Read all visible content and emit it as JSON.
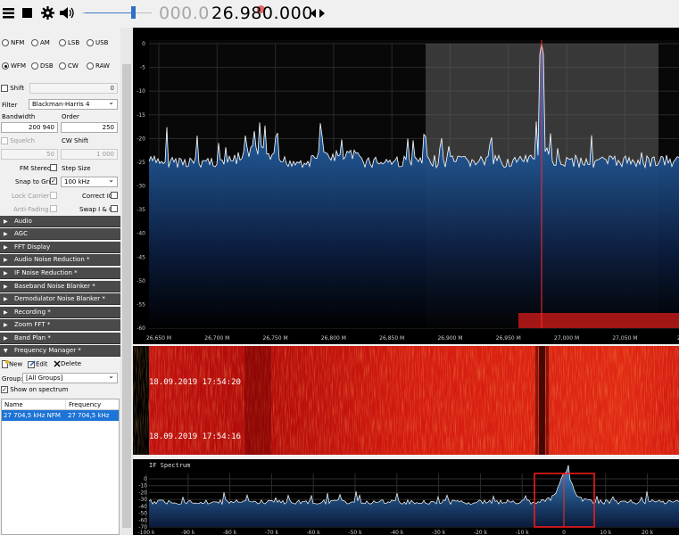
{
  "toolbar": {
    "freq_dim": "000.0",
    "freq_main": "26.980.000",
    "menu_icon": "hamburger-icon",
    "stop_icon": "stop-icon",
    "settings_icon": "gear-icon",
    "volume_icon": "speaker-icon",
    "tune_arrows_icon": "left-right-arrows-icon"
  },
  "radio": {
    "modes_row1": [
      "NFM",
      "AM",
      "LSB",
      "USB"
    ],
    "modes_row2": [
      "WFM",
      "DSB",
      "CW",
      "RAW"
    ],
    "selected": "WFM",
    "shift_label": "Shift",
    "shift_value": "0",
    "filter_label": "Filter",
    "filter_value": "Blackman-Harris 4",
    "bandwidth_label": "Bandwidth",
    "bandwidth_value": "200 940",
    "order_label": "Order",
    "order_value": "250",
    "squelch_label": "Squelch",
    "squelch_value": "50",
    "cw_shift_label": "CW Shift",
    "cw_shift_value": "1 000",
    "fm_stereo_label": "FM Stereo",
    "step_size_label": "Step Size",
    "snap_label": "Snap to Grid",
    "step_value": "100 kHz",
    "lock_carrier_label": "Lock Carrier",
    "correct_iq_label": "Correct IQ",
    "anti_fading_label": "Anti-Fading",
    "swap_iq_label": "Swap I & Q"
  },
  "sections": [
    "Audio",
    "AGC",
    "FFT Display",
    "Audio Noise Reduction *",
    "IF Noise Reduction *",
    "Baseband Noise Blanker *",
    "Demodulator Noise Blanker *",
    "Recording *",
    "Zoom FFT *",
    "Band Plan *",
    "Frequency Manager *"
  ],
  "freq_manager": {
    "new_label": "New",
    "edit_label": "Edit",
    "delete_label": "Delete",
    "group_label": "Group:",
    "group_value": "[All Groups]",
    "show_label": "Show on spectrum",
    "col_name": "Name",
    "col_freq": "Frequency",
    "row_name": "27 704,5 kHz NFM",
    "row_freq": "27 704,5 kHz"
  },
  "spectrum": {
    "y_ticks": [
      "0",
      "-5",
      "-10",
      "-15",
      "-20",
      "-25",
      "-30",
      "-35",
      "-40",
      "-45",
      "-50",
      "-55",
      "-60"
    ],
    "x_ticks": [
      "26,650 M",
      "26,700 M",
      "26,750 M",
      "26,800 M",
      "26,850 M",
      "26,900 M",
      "26,950 M",
      "27,000 M",
      "27,050 M",
      "27,1"
    ]
  },
  "waterfall": {
    "time1": "18.09.2019 17:54:20",
    "time2": "18.09.2019 17:54:16"
  },
  "if_spectrum": {
    "title": "IF Spectrum",
    "y_ticks": [
      "0",
      "-10",
      "-20",
      "-30",
      "-40",
      "-50",
      "-60",
      "-70"
    ],
    "x_ticks": [
      "-100 k",
      "-90 k",
      "-80 k",
      "-70 k",
      "-60 k",
      "-50 k",
      "-40 k",
      "-30 k",
      "-20 k",
      "-10 k",
      "0",
      "10 k",
      "20 k"
    ]
  },
  "colors": {
    "accent": "#2f7fd8",
    "marker": "#ff2020",
    "selected_row": "#1e74d6"
  }
}
